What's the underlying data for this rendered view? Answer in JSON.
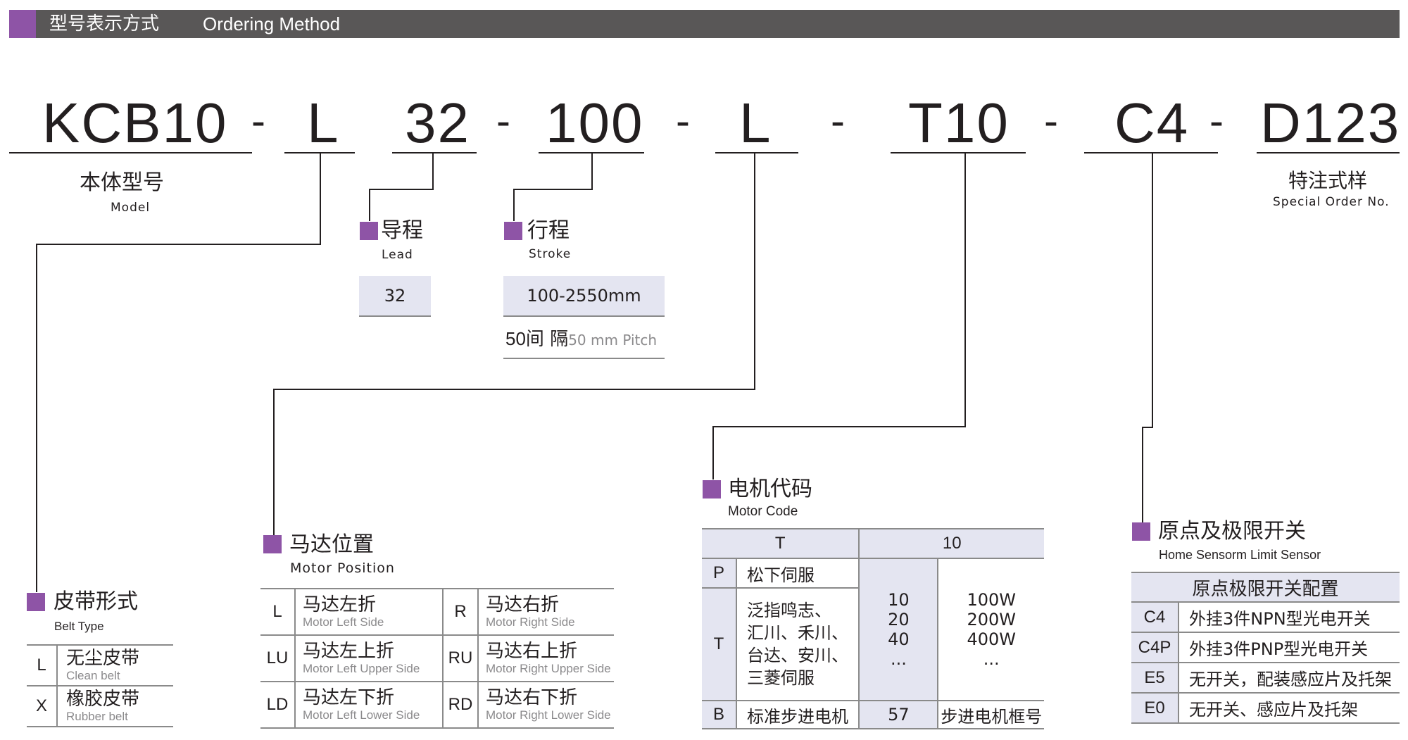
{
  "header": {
    "title_cn": "型号表示方式",
    "title_en": "Ordering Method"
  },
  "model_code": {
    "segments": [
      "KCB10",
      "L",
      "32",
      "100",
      "L",
      "T10",
      "C4",
      "D123"
    ],
    "separator": "-"
  },
  "model": {
    "cn": "本体型号",
    "en": "Model"
  },
  "special": {
    "cn": "特注式样",
    "en": "Special Order No."
  },
  "lead": {
    "cn": "导程",
    "en": "Lead",
    "value": "32"
  },
  "stroke": {
    "cn": "行程",
    "en": "Stroke",
    "value": "100-2550mm",
    "note_num": "50",
    "note_cn": "间 隔",
    "note_en": "50 mm Pitch"
  },
  "belt": {
    "cn": "皮带形式",
    "en": "Belt Type",
    "rows": [
      {
        "code": "L",
        "cn": "无尘皮带",
        "en": "Clean belt"
      },
      {
        "code": "X",
        "cn": "橡胶皮带",
        "en": "Rubber belt"
      }
    ]
  },
  "motor_position": {
    "cn": "马达位置",
    "en": "Motor Position",
    "rows": [
      {
        "code_l": "L",
        "cn_l": "马达左折",
        "en_l": "Motor Left Side",
        "code_r": "R",
        "cn_r": "马达右折",
        "en_r": "Motor Right Side"
      },
      {
        "code_l": "LU",
        "cn_l": "马达左上折",
        "en_l": "Motor Left Upper Side",
        "code_r": "RU",
        "cn_r": "马达右上折",
        "en_r": "Motor Right Upper Side"
      },
      {
        "code_l": "LD",
        "cn_l": "马达左下折",
        "en_l": "Motor Left Lower Side",
        "code_r": "RD",
        "cn_r": "马达右下折",
        "en_r": "Motor Right Lower Side"
      }
    ]
  },
  "motor_code": {
    "cn": "电机代码",
    "en": "Motor Code",
    "head_t": "T",
    "head_num": "10",
    "p_code": "P",
    "p_desc": "松下伺服",
    "t_code": "T",
    "t_desc": [
      "泛指鸣志、",
      "汇川、禾川、",
      "台达、安川、",
      "三菱伺服"
    ],
    "sizes": [
      "10",
      "20",
      "40",
      "..."
    ],
    "powers": [
      "100W",
      "200W",
      "400W",
      "..."
    ],
    "b_code": "B",
    "b_desc": "标准步进电机",
    "b_size": "57",
    "b_power": "步进电机框号"
  },
  "sensor": {
    "cn": "原点及极限开关",
    "en": "Home Sensorm Limit Sensor",
    "table_title": "原点极限开关配置",
    "rows": [
      {
        "code": "C4",
        "desc": "外挂3件NPN型光电开关"
      },
      {
        "code": "C4P",
        "desc": "外挂3件PNP型光电开关"
      },
      {
        "code": "E5",
        "desc": "无开关，配装感应片及托架"
      },
      {
        "code": "E0",
        "desc": "无开关、感应片及托架"
      }
    ]
  }
}
